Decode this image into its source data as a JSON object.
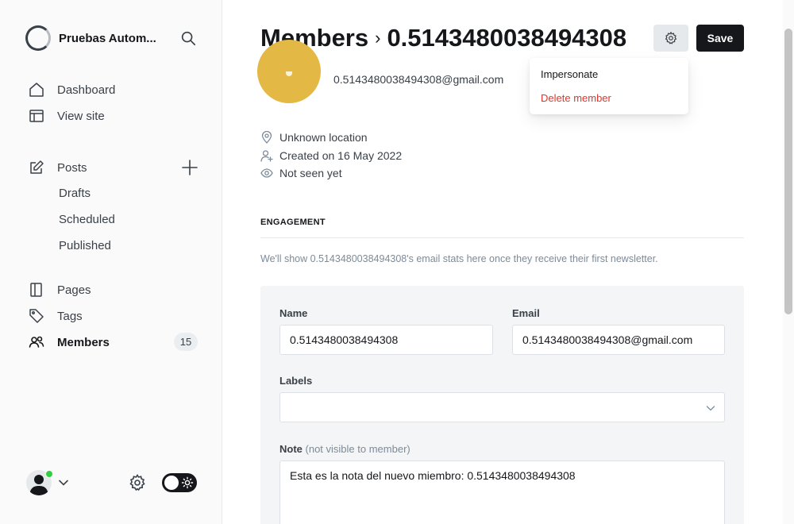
{
  "sidebar": {
    "brand_name": "Pruebas Autom...",
    "nav": {
      "dashboard": "Dashboard",
      "view_site": "View site",
      "posts": "Posts",
      "drafts": "Drafts",
      "scheduled": "Scheduled",
      "published": "Published",
      "pages": "Pages",
      "tags": "Tags",
      "members": "Members",
      "members_count": "15"
    }
  },
  "header": {
    "breadcrumb_root": "Members",
    "breadcrumb_separator": "›",
    "breadcrumb_current": "0.5143480038494308",
    "save_label": "Save"
  },
  "dropdown": {
    "impersonate": "Impersonate",
    "delete": "Delete member"
  },
  "member": {
    "email": "0.5143480038494308@gmail.com",
    "location": "Unknown location",
    "created": "Created on 16 May 2022",
    "last_seen": "Not seen yet"
  },
  "engagement": {
    "title": "ENGAGEMENT",
    "note": "We'll show 0.5143480038494308's email stats here once they receive their first newsletter."
  },
  "form": {
    "name_label": "Name",
    "name_value": "0.5143480038494308",
    "email_label": "Email",
    "email_value": "0.5143480038494308@gmail.com",
    "labels_label": "Labels",
    "note_label": "Note",
    "note_hint": "(not visible to member)",
    "note_value": "Esta es la nota del nuevo miembro: 0.5143480038494308"
  },
  "colors": {
    "accent_dark": "#15171a",
    "danger": "#e0352b",
    "avatar_yellow": "#e3b844",
    "online": "#30cf43"
  }
}
